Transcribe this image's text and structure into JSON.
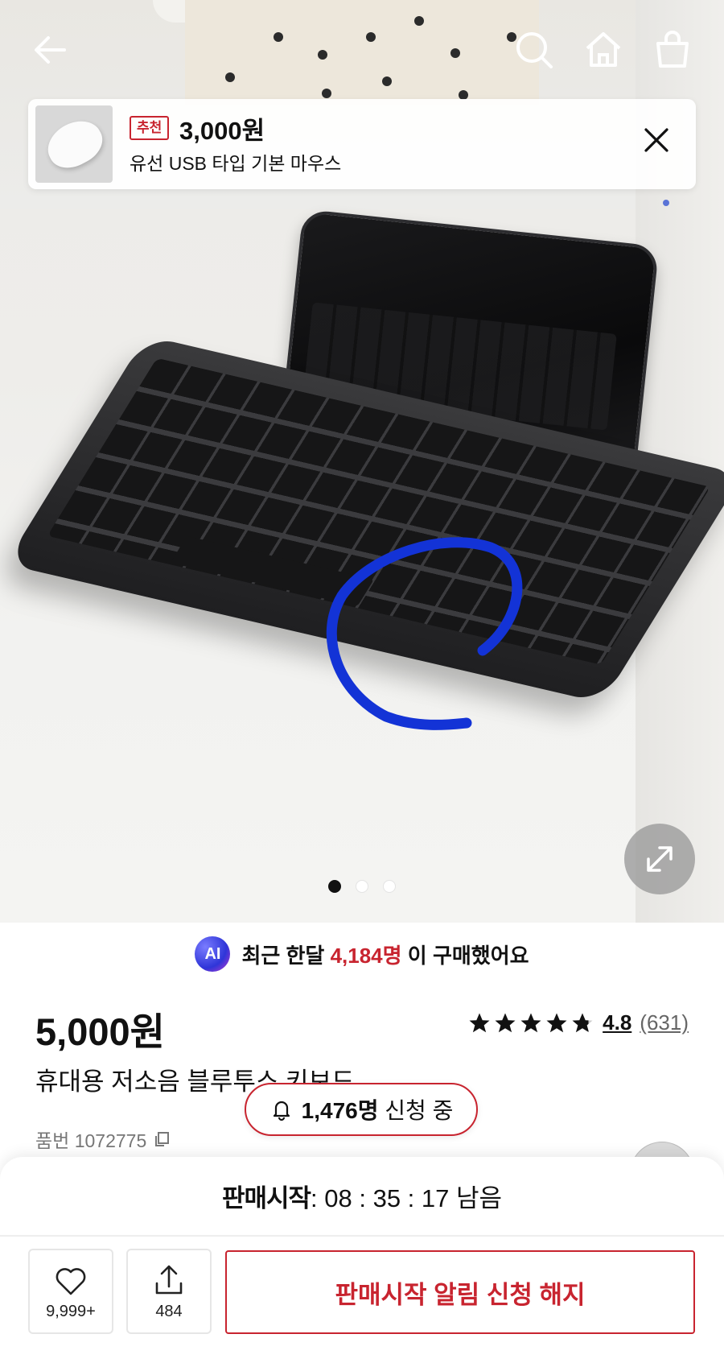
{
  "header": {
    "back_icon": "arrow-left-icon",
    "search_icon": "search-icon",
    "home_icon": "home-icon",
    "cart_icon": "shopping-bag-icon"
  },
  "recommendation": {
    "badge": "추천",
    "price": "3,000원",
    "name": "유선 USB 타입 기본 마우스"
  },
  "gallery": {
    "page_count": 3,
    "active_index": 0
  },
  "ai_purchase": {
    "badge": "AI",
    "prefix": "최근 한달",
    "count": "4,184명",
    "suffix": "이 구매했어요"
  },
  "product": {
    "price": "5,000원",
    "rating_score": "4.8",
    "rating_count": "(631)",
    "rating_value": 4.8,
    "name": "휴대용 저소음 블루투스 키보드",
    "sku_label": "품번 1072775"
  },
  "apply_pill": {
    "count": "1,476명",
    "text": "신청 중"
  },
  "sheet": {
    "timer_label": "판매시작",
    "timer_value": "08 : 35 : 17",
    "timer_suffix": "남음",
    "like_count": "9,999+",
    "share_count": "484",
    "cta_label": "판매시작 알림 신청 해지"
  },
  "colors": {
    "accent_red": "#c8242f",
    "scribble_blue": "#1333d6"
  }
}
